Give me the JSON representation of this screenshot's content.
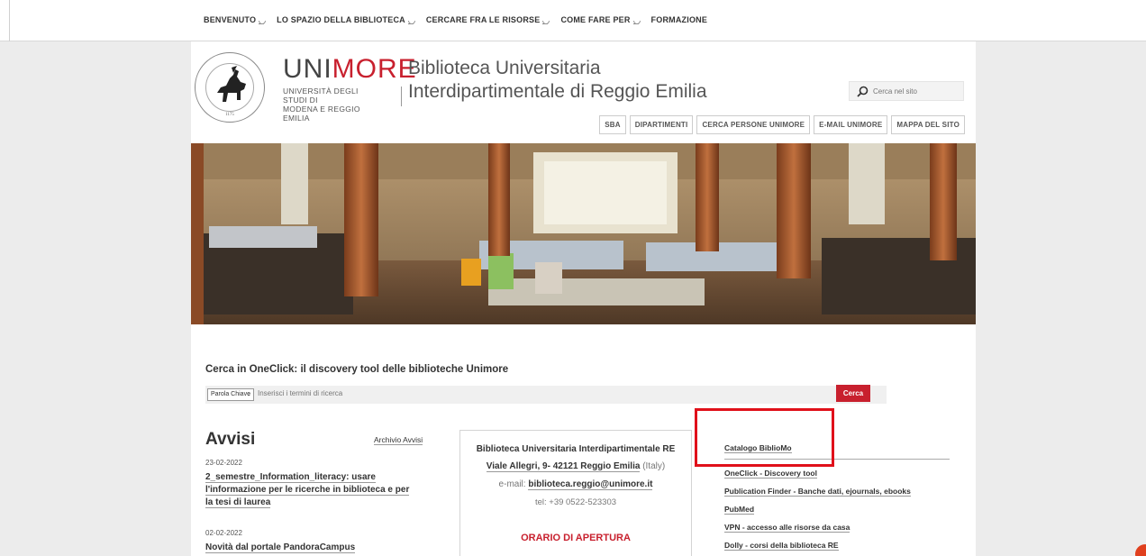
{
  "nav": {
    "items": [
      {
        "label": "BENVENUTO",
        "dropdown": true
      },
      {
        "label": "LO SPAZIO DELLA BIBLIOTECA",
        "dropdown": true
      },
      {
        "label": "CERCARE FRA LE RISORSE",
        "dropdown": true
      },
      {
        "label": "COME FARE PER",
        "dropdown": true
      },
      {
        "label": "FORMAZIONE",
        "dropdown": false
      }
    ]
  },
  "header": {
    "brand_main": "UNI",
    "brand_accent": "MORE",
    "brand_sub_line1": "UNIVERSITÀ DEGLI STUDI DI",
    "brand_sub_line2": "MODENA E REGGIO EMILIA",
    "seal_year": "1175",
    "library_title_line1": "Biblioteca Universitaria",
    "library_title_line2": "Interdipartimentale di Reggio Emilia",
    "search_placeholder": "Cerca nel sito",
    "links": [
      "SBA",
      "DIPARTIMENTI",
      "CERCA PERSONE UNIMORE",
      "E-MAIL UNIMORE",
      "MAPPA DEL SITO"
    ]
  },
  "oneclick": {
    "title": "Cerca in OneClick: il discovery tool delle biblioteche Unimore",
    "select_value": "Parola Chiave",
    "input_placeholder": "Inserisci i termini di ricerca",
    "button": "Cerca"
  },
  "avvisi": {
    "heading": "Avvisi",
    "archive_link": "Archivio Avvisi",
    "news": [
      {
        "date": "23-02-2022",
        "line1": "2_semestre_Information_literacy: usare",
        "line2": "l'informazione per le ricerche in biblioteca e per",
        "line3": "la tesi di laurea"
      },
      {
        "date": "02-02-2022",
        "line1": "Novità dal portale PandoraCampus"
      }
    ]
  },
  "info": {
    "name": "Biblioteca Universitaria Interdipartimentale RE",
    "address": "Viale Allegri, 9- 42121 Reggio Emilia",
    "country": "(Italy)",
    "email_label": "e-mail:",
    "email": "biblioteca.reggio@unimore.it",
    "tel": "tel: +39 0522-523303",
    "orario": "ORARIO DI APERTURA"
  },
  "right_links": [
    "Catalogo BiblioMo",
    "OneClick - Discovery tool",
    "Publication Finder - Banche dati, ejournals, ebooks",
    "PubMed",
    "VPN - accesso alle risorse da casa",
    "Dolly - corsi della biblioteca RE"
  ],
  "colors": {
    "accent": "#c8202e",
    "highlight": "#e0101a"
  }
}
